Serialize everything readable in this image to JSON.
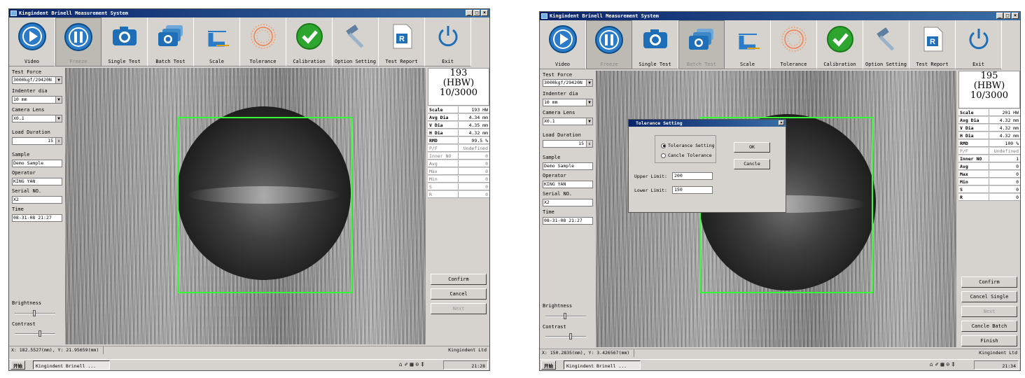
{
  "app": {
    "title": "Kingindent Brinell Measurement System",
    "window_buttons": [
      "_",
      "□",
      "×"
    ]
  },
  "toolbar": {
    "buttons": [
      {
        "label": "Video",
        "icon": "play-icon"
      },
      {
        "label": "Freeze",
        "icon": "pause-icon"
      },
      {
        "label": "Single Test",
        "icon": "camera-icon"
      },
      {
        "label": "Batch Test",
        "icon": "batch-camera-icon"
      },
      {
        "label": "Scale",
        "icon": "scale-icon"
      },
      {
        "label": "Tolerance",
        "icon": "tolerance-icon"
      },
      {
        "label": "Calibration",
        "icon": "check-icon"
      },
      {
        "label": "Option Setting",
        "icon": "hammer-icon"
      },
      {
        "label": "Test Report",
        "icon": "report-icon"
      },
      {
        "label": "Exit",
        "icon": "power-icon"
      }
    ]
  },
  "left_panel": {
    "test_force_label": "Test Force",
    "indenter_label": "Indenter dia",
    "camera_label": "Camera Lens",
    "load_label": "Load Duration",
    "sample_label": "Sample",
    "operator_label": "Operator",
    "serial_label": "Serial NO.",
    "time_label": "Time",
    "brightness_label": "Brightness",
    "contrast_label": "Contrast"
  },
  "screens": [
    {
      "fields": {
        "test_force": "3000kgf/29420N",
        "indenter": "10 mm",
        "camera": "X0.1",
        "load": "15",
        "sample": "Demo Sample",
        "operator": "KING YAN",
        "serial": "X2",
        "time": "08-31-08 21:27"
      },
      "result": {
        "value": "193",
        "unit": "(HBW)",
        "scale": "10/3000"
      },
      "stats": [
        {
          "k": "Scale",
          "v": "193 HW"
        },
        {
          "k": "Avg Dia",
          "v": "4.34 mm"
        },
        {
          "k": "V Dia",
          "v": "4.35 mm"
        },
        {
          "k": "H Dia",
          "v": "4.32 mm"
        },
        {
          "k": "RMD",
          "v": "99.5 %"
        },
        {
          "k": "P/F",
          "v": "Undefined"
        },
        {
          "k": "Inner NO",
          "v": "0"
        },
        {
          "k": "Avg",
          "v": "0"
        },
        {
          "k": "Max",
          "v": "0"
        },
        {
          "k": "Min",
          "v": "0"
        },
        {
          "k": "S",
          "v": "0"
        },
        {
          "k": "R",
          "v": "0"
        }
      ],
      "panel_buttons": [
        {
          "label": "Confirm",
          "enabled": true
        },
        {
          "label": "Cancel",
          "enabled": true
        },
        {
          "label": "Next",
          "enabled": false
        }
      ],
      "status": "X: 182.5527(mm), Y: 21.95659(mm)",
      "company": "Kingindent Ltd",
      "task_item": "Kingindent Brinell ...",
      "start": "开始",
      "clock": "21:28"
    },
    {
      "fields": {
        "test_force": "3000kgf/29420N",
        "indenter": "10 mm",
        "camera": "X0.1",
        "load": "15",
        "sample": "Demo Sample",
        "operator": "KING YAN",
        "serial": "X2",
        "time": "08-31-08 21:27"
      },
      "result": {
        "value": "195",
        "unit": "(HBW)",
        "scale": "10/3000"
      },
      "stats": [
        {
          "k": "Scale",
          "v": "201 HW"
        },
        {
          "k": "Avg Dia",
          "v": "4.32 mm"
        },
        {
          "k": "V Dia",
          "v": "4.32 mm"
        },
        {
          "k": "H Dia",
          "v": "4.32 mm"
        },
        {
          "k": "RMD",
          "v": "100 %"
        },
        {
          "k": "P/F",
          "v": "Undefined"
        },
        {
          "k": "Inner NO",
          "v": "1"
        },
        {
          "k": "Avg",
          "v": "0"
        },
        {
          "k": "Max",
          "v": "0"
        },
        {
          "k": "Min",
          "v": "0"
        },
        {
          "k": "S",
          "v": "0"
        },
        {
          "k": "R",
          "v": "0"
        }
      ],
      "panel_buttons": [
        {
          "label": "Confirm",
          "enabled": true
        },
        {
          "label": "Cancel Single",
          "enabled": true
        },
        {
          "label": "Next",
          "enabled": false
        },
        {
          "label": "Cancle Batch",
          "enabled": true
        },
        {
          "label": "Finish",
          "enabled": true
        }
      ],
      "status": "X: 150.2835(mm), Y: 3.426567(mm)",
      "company": "Kingindent Ltd",
      "task_item": "Kingindent Brinell ...",
      "start": "开始",
      "clock": "21:34",
      "dialog": {
        "title": "Tolerance Setting",
        "radio1": "Tolerance Setting",
        "radio2": "Cancle Tolerance",
        "ok": "OK",
        "cancel": "Cancle",
        "upper_label": "Upper Limit:",
        "upper_value": "200",
        "lower_label": "Lower Limit:",
        "lower_value": "150"
      }
    }
  ],
  "colors": {
    "accent_blue": "#1f7fc9",
    "overlay_green": "#33ff33",
    "title_bar": "#0a246a"
  }
}
